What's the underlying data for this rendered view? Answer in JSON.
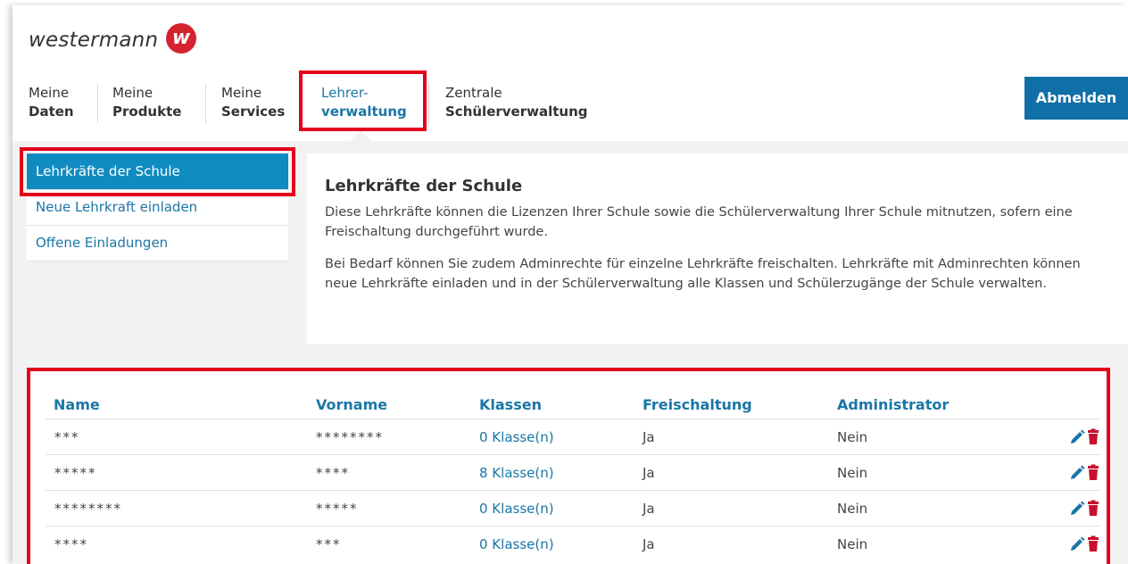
{
  "brand": {
    "wordmark": "westermann",
    "logo_letter": "w",
    "logo_color": "#d4232f"
  },
  "nav": {
    "items": [
      {
        "line1": "Meine",
        "line2": "Daten"
      },
      {
        "line1": "Meine",
        "line2": "Produkte"
      },
      {
        "line1": "Meine",
        "line2": "Services"
      },
      {
        "line1": "Lehrer-",
        "line2": "verwaltung",
        "active": true
      },
      {
        "line1": "Zentrale",
        "line2": "Schülerverwaltung"
      }
    ],
    "logout_label": "Abmelden"
  },
  "sidebar": {
    "items": [
      {
        "label": "Lehrkräfte der Schule",
        "active": true
      },
      {
        "label": "Neue Lehrkraft einladen"
      },
      {
        "label": "Offene Einladungen"
      }
    ]
  },
  "intro": {
    "title": "Lehrkräfte der Schule",
    "paragraph1": "Diese Lehrkräfte können die Lizenzen Ihrer Schule sowie die Schülerverwaltung Ihrer Schule mitnutzen, sofern eine Freischaltung durchgeführt wurde.",
    "paragraph2": "Bei Bedarf können Sie zudem Adminrechte für einzelne Lehrkräfte freischalten. Lehrkräfte mit Adminrechten können neue Lehrkräfte einladen und in der Schülerverwaltung alle Klassen und Schülerzugänge der Schule verwalten."
  },
  "table": {
    "headers": [
      "Name",
      "Vorname",
      "Klassen",
      "Freischaltung",
      "Administrator"
    ],
    "rows": [
      {
        "name": "***",
        "vorname": "********",
        "klassen": "0 Klasse(n)",
        "freischaltung": "Ja",
        "administrator": "Nein"
      },
      {
        "name": "*****",
        "vorname": "****",
        "klassen": "8 Klasse(n)",
        "freischaltung": "Ja",
        "administrator": "Nein"
      },
      {
        "name": "********",
        "vorname": "*****",
        "klassen": "0 Klasse(n)",
        "freischaltung": "Ja",
        "administrator": "Nein"
      },
      {
        "name": "****",
        "vorname": "***",
        "klassen": "0 Klasse(n)",
        "freischaltung": "Ja",
        "administrator": "Nein"
      }
    ],
    "action_icons": [
      "pencil-icon",
      "trash-icon"
    ]
  },
  "colors": {
    "accent": "#1a76a6",
    "button": "#0f6fa6",
    "sidebar_active": "#0f8bc2",
    "highlight": "#e4001b",
    "delete": "#c8102e"
  }
}
